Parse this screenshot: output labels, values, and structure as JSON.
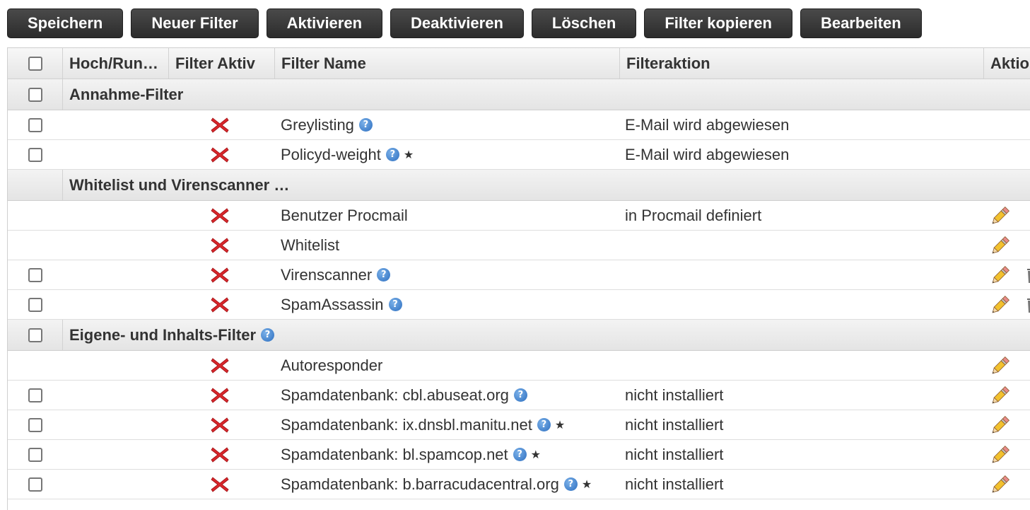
{
  "toolbar": {
    "buttons": [
      "Speichern",
      "Neuer Filter",
      "Aktivieren",
      "Deaktivieren",
      "Löschen",
      "Filter kopieren",
      "Bearbeiten"
    ]
  },
  "table": {
    "headers": {
      "hoch": "Hoch/Run…",
      "aktiv": "Filter Aktiv",
      "name": "Filter Name",
      "aktion": "Filteraktion",
      "ops": "Aktio"
    }
  },
  "groups": [
    {
      "title": "Annahme-Filter",
      "has_checkbox": true,
      "has_help": false,
      "rows": [
        {
          "name": "Greylisting",
          "action": "E-Mail wird abgewiesen",
          "checkbox": true,
          "active": false,
          "help": true,
          "star": false,
          "edit": false,
          "delete": false
        },
        {
          "name": "Policyd-weight",
          "action": "E-Mail wird abgewiesen",
          "checkbox": true,
          "active": false,
          "help": true,
          "star": true,
          "edit": false,
          "delete": false
        }
      ]
    },
    {
      "title": "Whitelist und Virenscanner …",
      "has_checkbox": false,
      "has_help": false,
      "rows": [
        {
          "name": "Benutzer Procmail",
          "action": "in Procmail definiert",
          "checkbox": false,
          "active": false,
          "help": false,
          "star": false,
          "edit": true,
          "delete": false
        },
        {
          "name": "Whitelist",
          "action": "",
          "checkbox": false,
          "active": false,
          "help": false,
          "star": false,
          "edit": true,
          "delete": false
        },
        {
          "name": "Virenscanner",
          "action": "",
          "checkbox": true,
          "active": false,
          "help": true,
          "star": false,
          "edit": true,
          "delete": true
        },
        {
          "name": "SpamAssassin",
          "action": "",
          "checkbox": true,
          "active": false,
          "help": true,
          "star": false,
          "edit": true,
          "delete": true
        }
      ]
    },
    {
      "title": "Eigene- und Inhalts-Filter",
      "has_checkbox": true,
      "has_help": true,
      "rows": [
        {
          "name": "Autoresponder",
          "action": "",
          "checkbox": false,
          "active": false,
          "help": false,
          "star": false,
          "edit": true,
          "delete": false
        },
        {
          "name": "Spamdatenbank: cbl.abuseat.org",
          "action": "nicht installiert",
          "checkbox": true,
          "active": false,
          "help": true,
          "star": false,
          "edit": true,
          "delete": false
        },
        {
          "name": "Spamdatenbank: ix.dnsbl.manitu.net",
          "action": "nicht installiert",
          "checkbox": true,
          "active": false,
          "help": true,
          "star": true,
          "edit": true,
          "delete": false
        },
        {
          "name": "Spamdatenbank: bl.spamcop.net",
          "action": "nicht installiert",
          "checkbox": true,
          "active": false,
          "help": true,
          "star": true,
          "edit": true,
          "delete": false
        },
        {
          "name": "Spamdatenbank: b.barracudacentral.org",
          "action": "nicht installiert",
          "checkbox": true,
          "active": false,
          "help": true,
          "star": true,
          "edit": true,
          "delete": false
        }
      ]
    }
  ],
  "icons": {
    "help_glyph": "?",
    "star_glyph": "★",
    "inactive": "red-x-icon",
    "edit": "pencil-icon",
    "delete": "trash-icon"
  },
  "colors": {
    "button_bg": "#333333",
    "inactive_red": "#d9262b",
    "help_blue": "#3a7fd0",
    "pencil_yellow": "#f2c12e"
  }
}
